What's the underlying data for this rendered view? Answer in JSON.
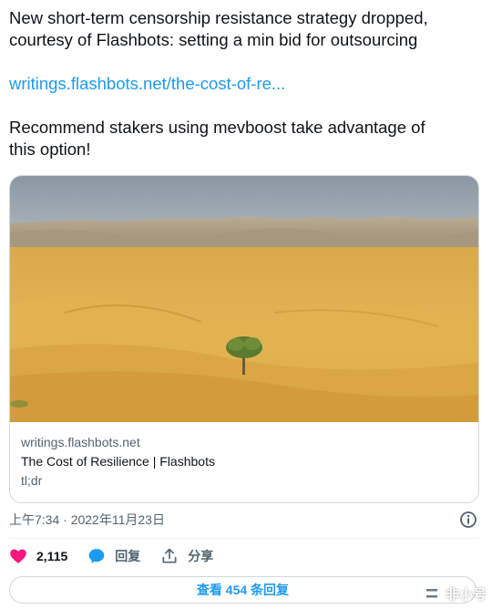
{
  "tweet": {
    "line1": "New short-term censorship resistance strategy dropped,",
    "line2": "courtesy of Flashbots: setting a min bid for outsourcing",
    "link_text": "writings.flashbots.net/the-cost-of-re...",
    "line3": "Recommend stakers using mevboost take advantage of",
    "line4": "this option!"
  },
  "card": {
    "domain": "writings.flashbots.net",
    "title": "The Cost of Resilience | Flashbots",
    "description": "tl;dr",
    "image_alt": "desert dunes with a lone tree"
  },
  "meta": {
    "timestamp": "上午7:34 · 2022年11月23日",
    "info_icon": "info-icon"
  },
  "actions": {
    "likes": "2,115",
    "reply_label": "回复",
    "share_label": "分享"
  },
  "replies_button": {
    "label": "查看 454 条回复"
  },
  "watermark": {
    "text": "非小号"
  },
  "colors": {
    "accent": "#1d9bf0",
    "like": "#f91880",
    "text": "#0f1419",
    "secondary": "#536471",
    "border": "#cfd9de"
  }
}
